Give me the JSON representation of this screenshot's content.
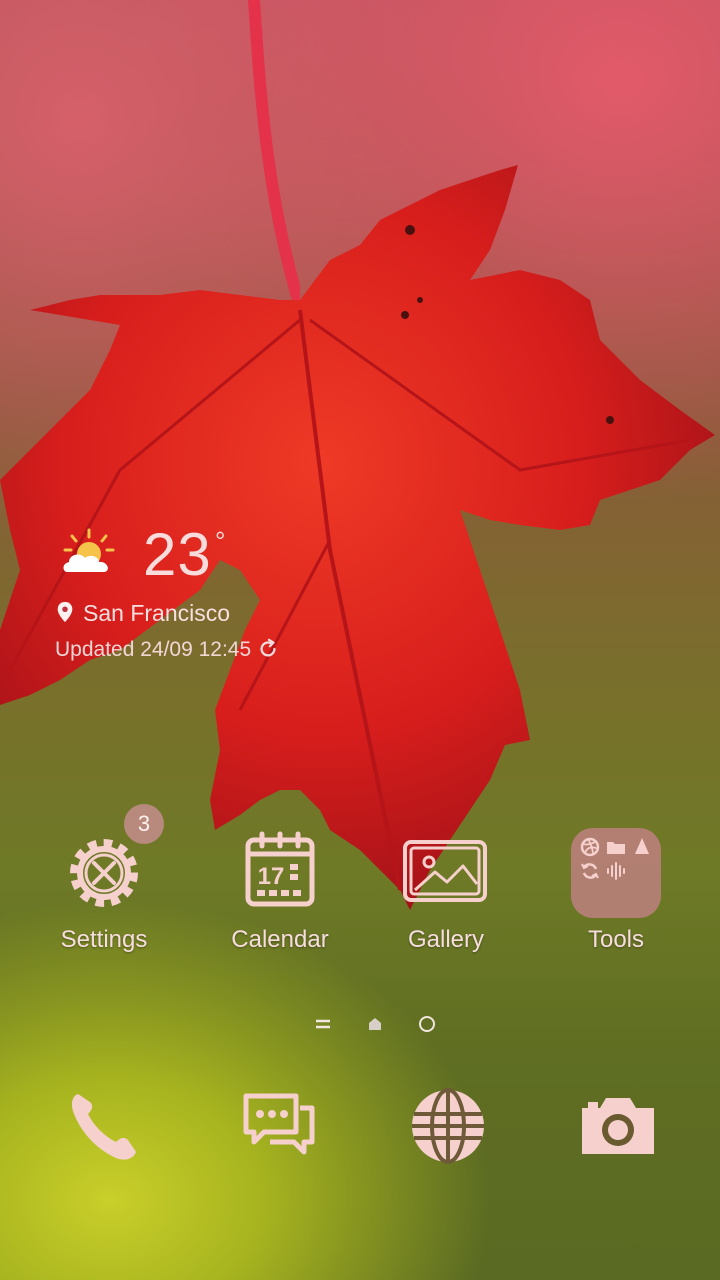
{
  "weather": {
    "temperature": "23",
    "unit": "°",
    "location": "San Francisco",
    "updated": "Updated 24/09 12:45",
    "icon": "partly-sunny-icon"
  },
  "apps": [
    {
      "label": "Settings",
      "icon": "settings-icon",
      "badge": "3"
    },
    {
      "label": "Calendar",
      "icon": "calendar-icon",
      "date": "17"
    },
    {
      "label": "Gallery",
      "icon": "gallery-icon"
    },
    {
      "label": "Tools",
      "icon": "tools-folder-icon"
    }
  ],
  "page_indicator": {
    "items": [
      "menu-indicator-icon",
      "home-indicator-icon",
      "page-dot-icon"
    ]
  },
  "dock": [
    "phone-icon",
    "messages-icon",
    "browser-icon",
    "camera-icon"
  ],
  "colors": {
    "icon_tint": "#f5d0cc",
    "label_color": "#f7dede",
    "leaf_red": "#e0201c",
    "badge_bg": "#b88a7e"
  }
}
